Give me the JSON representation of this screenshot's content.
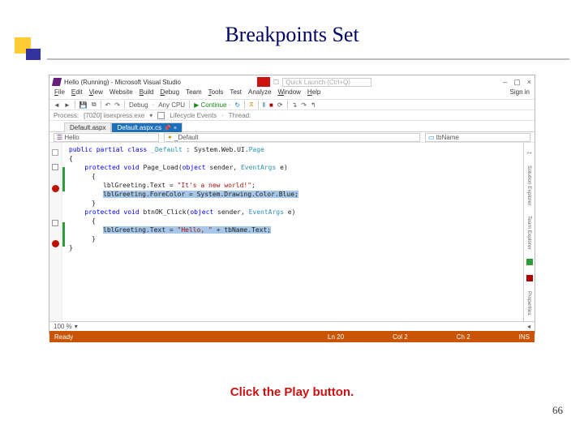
{
  "slide": {
    "title": "Breakpoints Set",
    "caption": "Click the Play button.",
    "page": "66"
  },
  "ide": {
    "title": "Hello (Running) - Microsoft Visual Studio",
    "quicklaunch": "Quick Launch (Ctrl+Q)",
    "signin": "Sign in",
    "winmin": "–",
    "winmax": "▢",
    "winclose": "×",
    "menu": {
      "file": "File",
      "edit": "Edit",
      "view": "View",
      "website": "Website",
      "build": "Build",
      "debug": "Debug",
      "team": "Team",
      "tools": "Tools",
      "test": "Test",
      "analyze": "Analyze",
      "window": "Window",
      "help": "Help"
    },
    "toolbar": {
      "config": "Debug",
      "platform": "Any CPU",
      "continue": "Continue",
      "refresh_icon": "↻"
    },
    "toolbar2": {
      "process_label": "Process:",
      "process": "[7020] iisexpress.exe",
      "events": "Lifecycle Events",
      "thread": "Thread:"
    },
    "tabs": {
      "t1": "Default.aspx",
      "t2": "Default.aspx.cs",
      "pin": "📌",
      "close": "×"
    },
    "drops": {
      "d1": "Hello",
      "d2": "_Default",
      "d3": "tbName"
    },
    "code": {
      "l1": "public partial class _Default : System.Web.UI.Page",
      "l2": "{",
      "l3": "    protected void Page_Load(object sender, EventArgs e)",
      "l4": "    {",
      "l5_a": "        lblGreeting.Text = ",
      "l5_b": "\"It's a new world!\"",
      "l5_c": ";",
      "l6": "        lblGreeting.ForeColor = System.Drawing.Color.Blue;",
      "l7": "    }",
      "l8": "",
      "l9": "    protected void btnOK_Click(object sender, EventArgs e)",
      "l10": "    {",
      "l11_a": "        lblGreeting.Text = ",
      "l11_b": "\"Hello, \"",
      "l11_c": " + tbName.Text;",
      "l12": "    }",
      "l13": "}"
    },
    "zoom": "100 %",
    "rside": {
      "t1": "Solution Explorer",
      "t2": "Team Explorer",
      "t3": "Properties"
    },
    "status": {
      "ready": "Ready",
      "ln": "Ln 20",
      "col": "Col 2",
      "ch": "Ch 2",
      "ins": "INS"
    }
  }
}
